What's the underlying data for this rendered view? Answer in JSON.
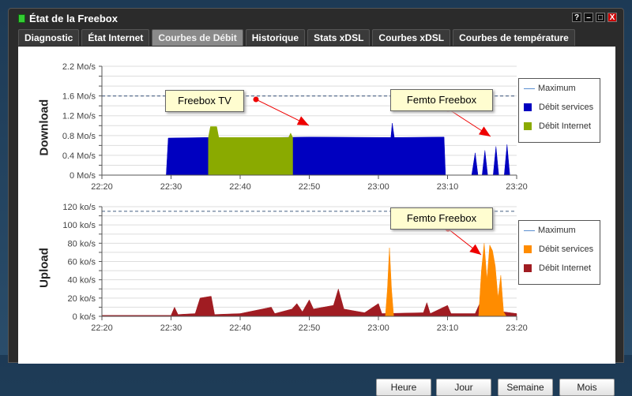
{
  "window": {
    "title": "État de la Freebox",
    "controls": [
      "?",
      "–",
      "□",
      "X"
    ]
  },
  "tabs": [
    {
      "label": "Diagnostic"
    },
    {
      "label": "État Internet"
    },
    {
      "label": "Courbes de Débit",
      "active": true
    },
    {
      "label": "Historique"
    },
    {
      "label": "Stats xDSL"
    },
    {
      "label": "Courbes xDSL"
    },
    {
      "label": "Courbes de température"
    }
  ],
  "buttons": {
    "hour": "Heure",
    "day": "Jour",
    "week": "Semaine",
    "month": "Mois"
  },
  "colors": {
    "dl_services": "#0000c0",
    "dl_internet": "#8aaa00",
    "ul_services": "#ff8c00",
    "ul_internet": "#a01c22",
    "maximum": "#5b8fd0"
  },
  "chart_data": [
    {
      "type": "area",
      "title": "Download",
      "ylabel": "Download",
      "unit": "Mo/s",
      "ylim": [
        0,
        2.2
      ],
      "yticks": [
        "0 Mo/s",
        "0.4 Mo/s",
        "0.8 Mo/s",
        "1.2 Mo/s",
        "1.6 Mo/s",
        "2.2 Mo/s"
      ],
      "ytick_values": [
        0,
        0.4,
        0.8,
        1.2,
        1.6,
        2.2
      ],
      "xticks": [
        "22:20",
        "22:30",
        "22:40",
        "22:50",
        "23:00",
        "23:10",
        "23:20"
      ],
      "xlim_minutes": [
        0,
        60
      ],
      "maximum": 1.6,
      "legend": [
        "Maximum",
        "Débit services",
        "Débit Internet"
      ],
      "annotations": [
        {
          "text": "Freebox TV"
        },
        {
          "text": "Femto Freebox"
        }
      ],
      "series": [
        {
          "name": "Débit services",
          "points": [
            [
              0,
              0
            ],
            [
              9.3,
              0
            ],
            [
              9.6,
              0.75
            ],
            [
              15,
              0.76
            ],
            [
              20,
              0.75
            ],
            [
              30,
              0.77
            ],
            [
              41.8,
              0.76
            ],
            [
              42,
              1.05
            ],
            [
              42.3,
              0.76
            ],
            [
              49.5,
              0.77
            ],
            [
              49.7,
              0
            ],
            [
              53.5,
              0
            ],
            [
              54,
              0.45
            ],
            [
              54.4,
              0
            ],
            [
              55,
              0
            ],
            [
              55.4,
              0.5
            ],
            [
              55.8,
              0
            ],
            [
              56.6,
              0
            ],
            [
              57,
              0.58
            ],
            [
              57.4,
              0
            ],
            [
              58.2,
              0
            ],
            [
              58.6,
              0.62
            ],
            [
              59,
              0
            ],
            [
              60,
              0
            ]
          ]
        },
        {
          "name": "Débit Internet",
          "points": [
            [
              15.4,
              0.76
            ],
            [
              15.7,
              0.98
            ],
            [
              16.6,
              0.98
            ],
            [
              16.9,
              0.76
            ],
            [
              27,
              0.76
            ],
            [
              27.3,
              0.85
            ],
            [
              27.6,
              0.76
            ]
          ]
        }
      ]
    },
    {
      "type": "area",
      "title": "Upload",
      "ylabel": "Upload",
      "unit": "ko/s",
      "ylim": [
        0,
        120
      ],
      "yticks": [
        "0 ko/s",
        "20 ko/s",
        "40 ko/s",
        "60 ko/s",
        "80 ko/s",
        "100 ko/s",
        "120 ko/s"
      ],
      "ytick_values": [
        0,
        20,
        40,
        60,
        80,
        100,
        120
      ],
      "xticks": [
        "22:20",
        "22:30",
        "22:40",
        "22:50",
        "23:00",
        "23:10",
        "23:20"
      ],
      "xlim_minutes": [
        0,
        60
      ],
      "maximum": 115,
      "legend": [
        "Maximum",
        "Débit services",
        "Débit Internet"
      ],
      "annotations": [
        {
          "text": "Femto Freebox"
        }
      ],
      "series": [
        {
          "name": "Débit Internet",
          "points": [
            [
              0,
              1
            ],
            [
              10,
              1
            ],
            [
              10.5,
              10
            ],
            [
              11,
              2
            ],
            [
              13.5,
              3
            ],
            [
              14.2,
              20
            ],
            [
              15.8,
              22
            ],
            [
              16.3,
              2
            ],
            [
              20,
              3
            ],
            [
              24.5,
              10
            ],
            [
              25,
              3
            ],
            [
              27.5,
              8
            ],
            [
              28.2,
              14
            ],
            [
              29,
              5
            ],
            [
              30,
              18
            ],
            [
              30.6,
              8
            ],
            [
              33.5,
              12
            ],
            [
              34.2,
              30
            ],
            [
              35,
              8
            ],
            [
              36.5,
              6
            ],
            [
              38,
              4
            ],
            [
              40,
              14
            ],
            [
              40.5,
              3
            ],
            [
              46.5,
              4
            ],
            [
              47,
              15
            ],
            [
              47.5,
              3
            ],
            [
              50,
              12
            ],
            [
              50.5,
              3
            ],
            [
              54,
              3
            ],
            [
              55,
              20
            ],
            [
              57,
              18
            ],
            [
              58,
              5
            ],
            [
              60,
              3
            ]
          ]
        },
        {
          "name": "Débit services",
          "points": [
            [
              41,
              0
            ],
            [
              41.3,
              30
            ],
            [
              41.6,
              75
            ],
            [
              41.9,
              30
            ],
            [
              42.2,
              0
            ],
            [
              54.5,
              0
            ],
            [
              54.9,
              50
            ],
            [
              55.3,
              80
            ],
            [
              55.7,
              40
            ],
            [
              56.1,
              78
            ],
            [
              56.5,
              72
            ],
            [
              56.9,
              55
            ],
            [
              57.3,
              20
            ],
            [
              57.7,
              45
            ],
            [
              58.1,
              5
            ],
            [
              58.5,
              0
            ]
          ]
        }
      ]
    }
  ]
}
